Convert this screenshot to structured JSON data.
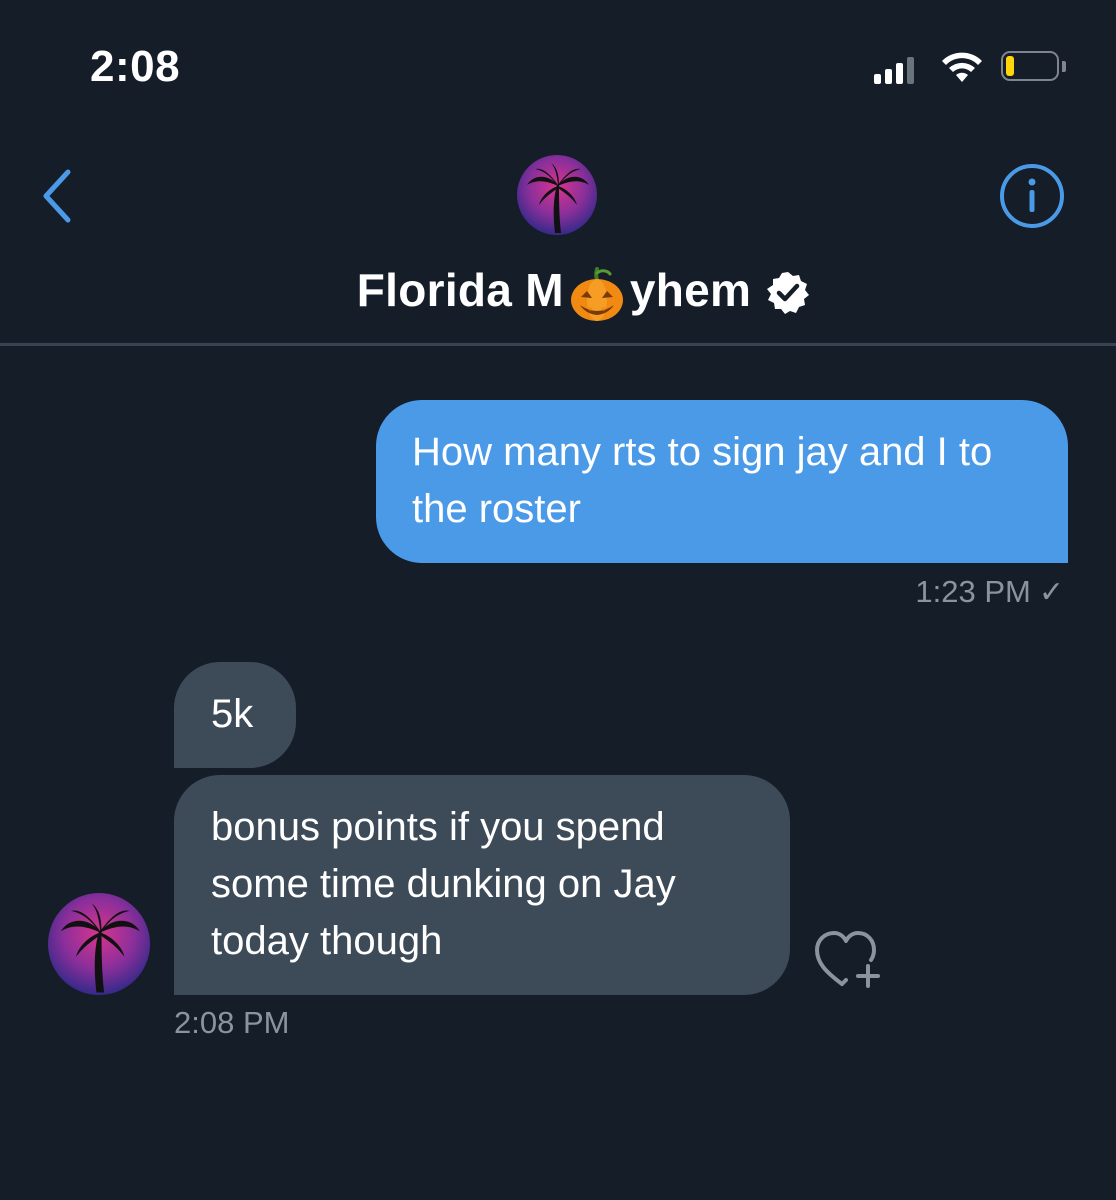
{
  "status_bar": {
    "time": "2:08",
    "battery_level_fraction": 0.15,
    "battery_color": "#ffd60a"
  },
  "header": {
    "back_icon": "chevron-left-icon",
    "name_before": "Florida M",
    "name_emoji": "jack-o-lantern-emoji",
    "name_after": "yhem",
    "verified_icon": "verified-badge-icon",
    "info_icon": "info-icon",
    "accent_color": "#4a9ae8"
  },
  "messages": [
    {
      "direction": "sent",
      "text": "How many rts to sign jay and I to the roster",
      "time": "1:23 PM",
      "status_icon": "check-icon",
      "status_glyph": "✓",
      "bubble_color": "#4a9ae8"
    },
    {
      "direction": "received",
      "text": "5k",
      "bubble_color": "#3d4a58"
    },
    {
      "direction": "received",
      "text": "bonus points if you spend some time dunking on Jay today though",
      "time": "2:08 PM",
      "reaction_icon": "heart-plus-icon",
      "bubble_color": "#3d4a58"
    }
  ]
}
